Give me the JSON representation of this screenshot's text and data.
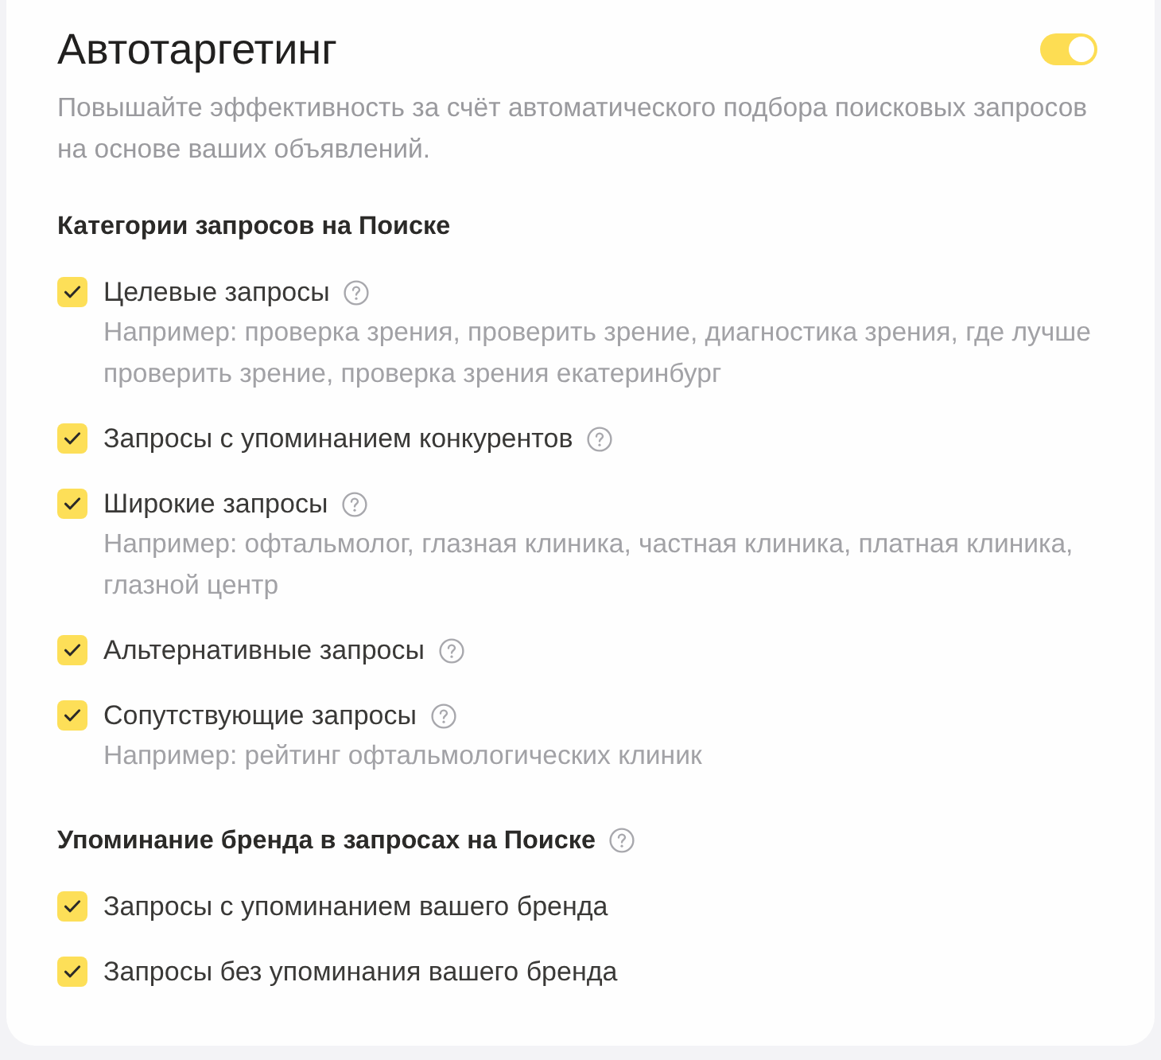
{
  "title": "Автотаргетинг",
  "toggle": {
    "on": true
  },
  "description": "Повышайте эффективность за счёт автоматического подбора поисковых запросов на основе ваших объявлений.",
  "sections": [
    {
      "heading": "Категории запросов на Поиске",
      "help": false,
      "items": [
        {
          "label": "Целевые запросы",
          "checked": true,
          "help": true,
          "example": "Например: проверка зрения, проверить зрение, диагностика зрения, где лучше проверить зрение, проверка зрения екатеринбург"
        },
        {
          "label": "Запросы с упоминанием конкурентов",
          "checked": true,
          "help": true
        },
        {
          "label": "Широкие запросы",
          "checked": true,
          "help": true,
          "example": "Например: офтальмолог, глазная клиника, частная клиника, платная клиника, глазной центр"
        },
        {
          "label": "Альтернативные запросы",
          "checked": true,
          "help": true
        },
        {
          "label": "Сопутствующие запросы",
          "checked": true,
          "help": true,
          "example": "Например: рейтинг офтальмологических клиник"
        }
      ]
    },
    {
      "heading": "Упоминание бренда в запросах на Поиске",
      "help": true,
      "items": [
        {
          "label": "Запросы с упоминанием вашего бренда",
          "checked": true,
          "help": false
        },
        {
          "label": "Запросы без упоминания вашего бренда",
          "checked": true,
          "help": false
        }
      ]
    }
  ]
}
